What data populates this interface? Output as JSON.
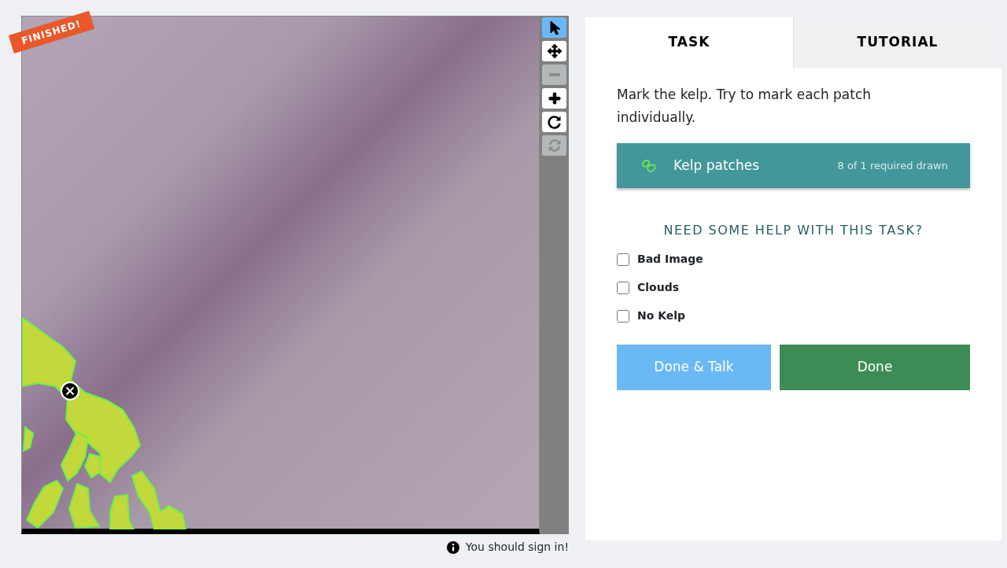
{
  "badge": "FINISHED!",
  "toolbar": [
    {
      "kind": "select",
      "selected": true,
      "disabled": false
    },
    {
      "kind": "move",
      "selected": false,
      "disabled": false
    },
    {
      "kind": "zoom-out",
      "selected": false,
      "disabled": true
    },
    {
      "kind": "zoom-in",
      "selected": false,
      "disabled": false
    },
    {
      "kind": "rotate",
      "selected": false,
      "disabled": false
    },
    {
      "kind": "reset",
      "selected": false,
      "disabled": true
    }
  ],
  "tabs": [
    {
      "label": "TASK",
      "selected": true
    },
    {
      "label": "TUTORIAL",
      "selected": false
    }
  ],
  "instruction": "Mark the kelp. Try to mark each patch individually.",
  "tools": [
    {
      "label": "Kelp patches",
      "count": "8 of 1 required drawn"
    }
  ],
  "help_heading": "NEED SOME HELP WITH THIS TASK?",
  "checkboxes": [
    {
      "label": "Bad Image",
      "checked": false
    },
    {
      "label": "Clouds",
      "checked": false
    },
    {
      "label": "No Kelp",
      "checked": false
    }
  ],
  "buttons": [
    {
      "label": "Done & Talk",
      "kind": "talk"
    },
    {
      "label": "Done",
      "kind": "done"
    }
  ],
  "sign_in": "You should sign in!"
}
